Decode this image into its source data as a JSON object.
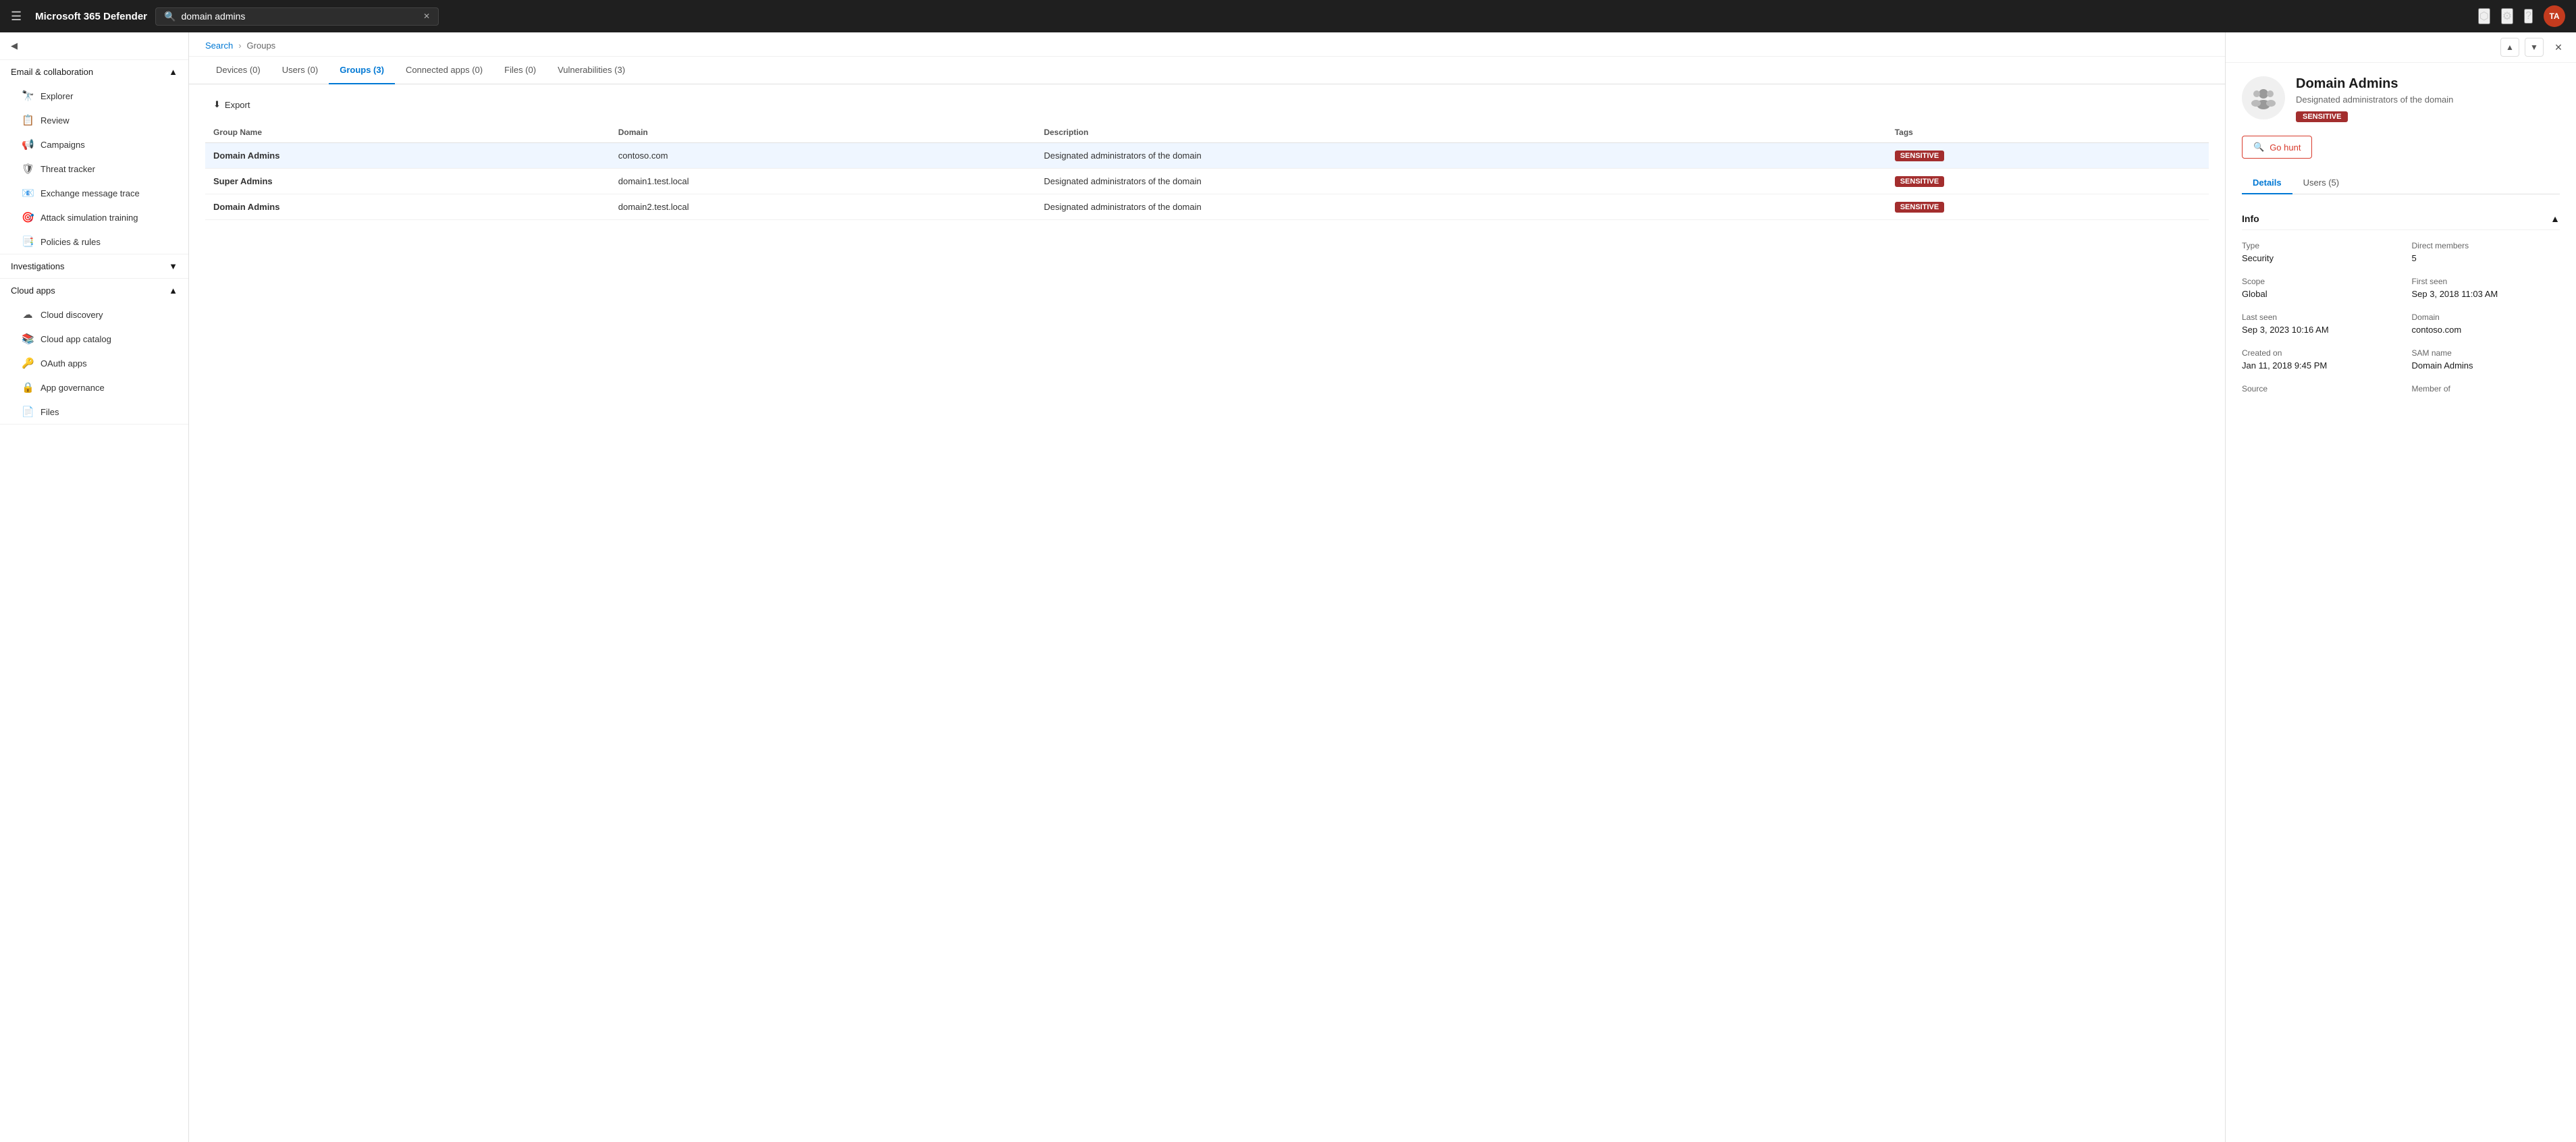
{
  "app": {
    "title": "Microsoft 365 Defender"
  },
  "topNav": {
    "searchPlaceholder": "domain admins",
    "searchValue": "domain admins",
    "avatarInitials": "TA"
  },
  "sidebar": {
    "sections": [
      {
        "label": "Email & collaboration",
        "expanded": true,
        "items": [
          {
            "label": "Explorer",
            "icon": "🔭"
          },
          {
            "label": "Review",
            "icon": "📋"
          },
          {
            "label": "Campaigns",
            "icon": "📢"
          },
          {
            "label": "Threat tracker",
            "icon": "🛡"
          },
          {
            "label": "Exchange message trace",
            "icon": "📧"
          },
          {
            "label": "Attack simulation training",
            "icon": "🎯"
          },
          {
            "label": "Policies & rules",
            "icon": "📑"
          }
        ]
      },
      {
        "label": "Investigations",
        "expanded": false,
        "items": []
      },
      {
        "label": "Cloud apps",
        "expanded": true,
        "items": [
          {
            "label": "Cloud discovery",
            "icon": "☁"
          },
          {
            "label": "Cloud app catalog",
            "icon": "📚"
          },
          {
            "label": "OAuth apps",
            "icon": "🔑"
          },
          {
            "label": "App governance",
            "icon": "🔒"
          },
          {
            "label": "Files",
            "icon": "📄"
          }
        ]
      }
    ]
  },
  "breadcrumb": {
    "items": [
      "Search",
      "Groups"
    ]
  },
  "tabs": [
    {
      "label": "Devices (0)",
      "active": false
    },
    {
      "label": "Users (0)",
      "active": false
    },
    {
      "label": "Groups (3)",
      "active": true
    },
    {
      "label": "Connected apps (0)",
      "active": false
    },
    {
      "label": "Files (0)",
      "active": false
    },
    {
      "label": "Vulnerabilities (3)",
      "active": false
    }
  ],
  "toolbar": {
    "exportLabel": "Export"
  },
  "table": {
    "columns": [
      "Group Name",
      "Domain",
      "Description",
      "Tags"
    ],
    "rows": [
      {
        "groupName": "Domain Admins",
        "domain": "contoso.com",
        "description": "Designated administrators of the domain",
        "tag": "SENSITIVE",
        "selected": true
      },
      {
        "groupName": "Super Admins",
        "domain": "domain1.test.local",
        "description": "Designated administrators of the domain",
        "tag": "SENSITIVE",
        "selected": false
      },
      {
        "groupName": "Domain Admins",
        "domain": "domain2.test.local",
        "description": "Designated administrators of the domain",
        "tag": "SENSITIVE",
        "selected": false
      }
    ]
  },
  "detailPanel": {
    "title": "Domain Admins",
    "subtitle": "Designated administrators of the domain",
    "sensitiveBadge": "SENSITIVE",
    "goHuntLabel": "Go hunt",
    "tabs": [
      {
        "label": "Details",
        "active": true
      },
      {
        "label": "Users (5)",
        "active": false
      }
    ],
    "infoSectionLabel": "Info",
    "fields": {
      "type": {
        "label": "Type",
        "value": "Security"
      },
      "directMembers": {
        "label": "Direct members",
        "value": "5"
      },
      "scope": {
        "label": "Scope",
        "value": "Global"
      },
      "firstSeen": {
        "label": "First seen",
        "value": "Sep 3, 2018 11:03 AM"
      },
      "lastSeen": {
        "label": "Last seen",
        "value": "Sep 3, 2023 10:16 AM"
      },
      "domain": {
        "label": "Domain",
        "value": "contoso.com"
      },
      "createdOn": {
        "label": "Created on",
        "value": "Jan 11, 2018 9:45 PM"
      },
      "samName": {
        "label": "SAM name",
        "value": "Domain Admins"
      },
      "source": {
        "label": "Source",
        "value": ""
      },
      "memberOf": {
        "label": "Member of",
        "value": ""
      }
    }
  }
}
